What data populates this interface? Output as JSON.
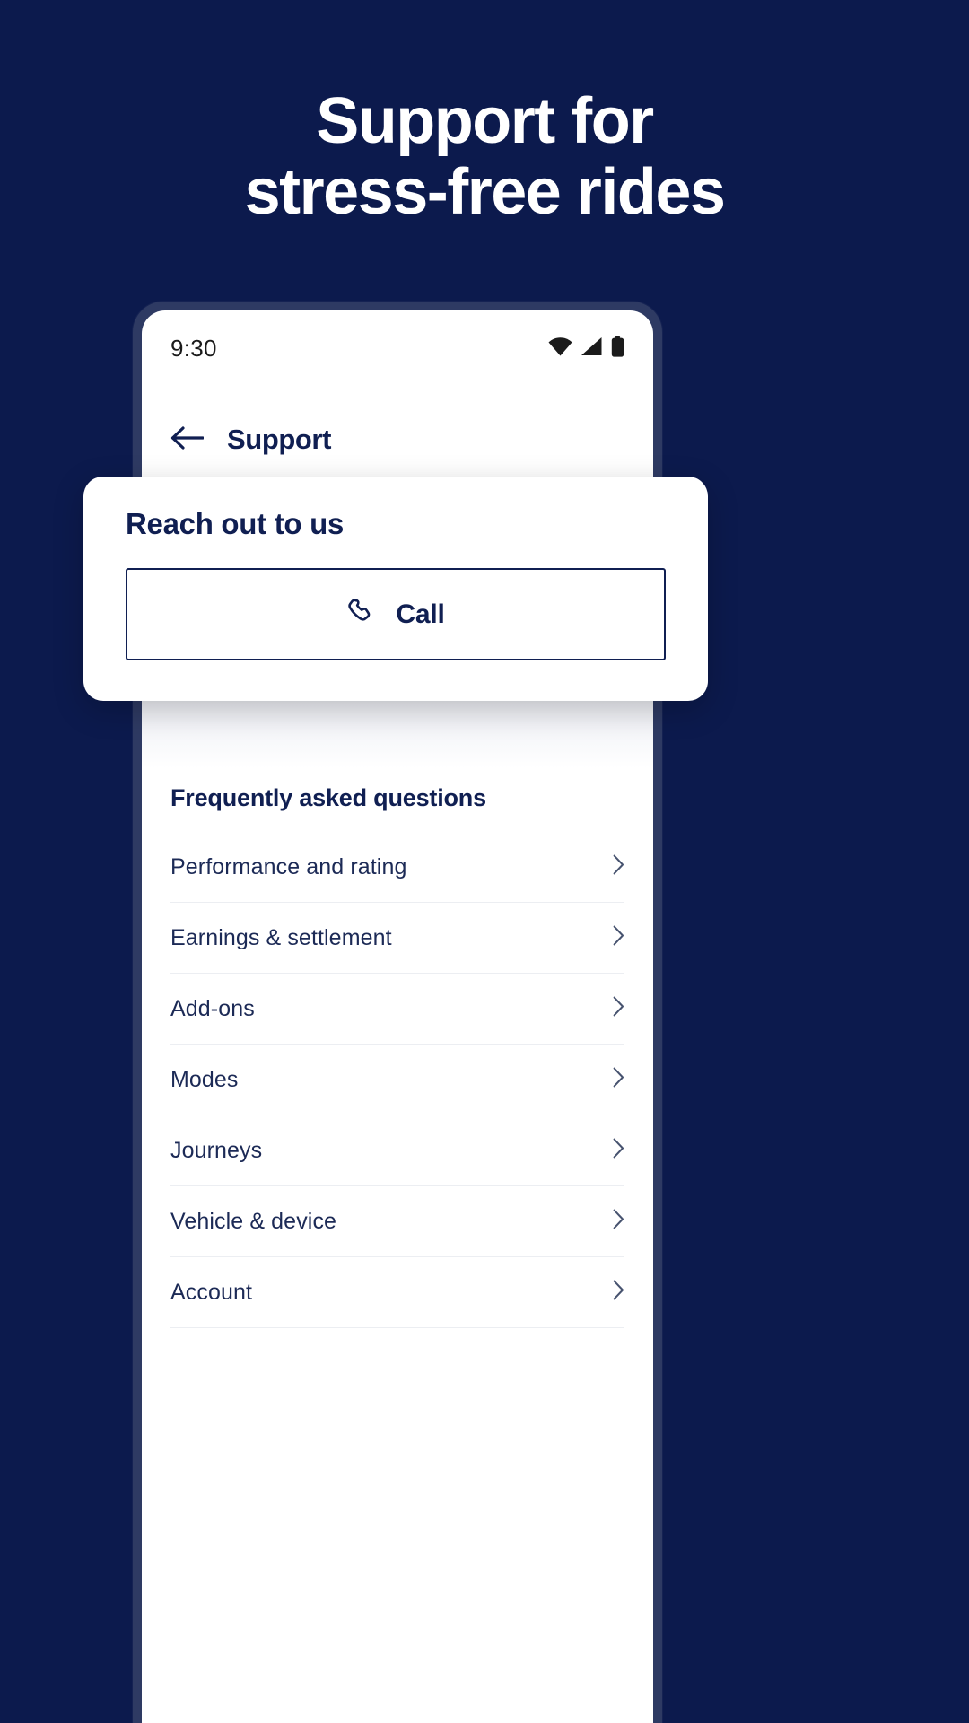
{
  "promo": {
    "background_color": "#0c1a4d",
    "headline_line1": "Support for",
    "headline_line2": "stress-free rides"
  },
  "phone": {
    "status_bar": {
      "time": "9:30",
      "icons": [
        "wifi-icon",
        "cellular-signal-icon",
        "battery-icon"
      ]
    },
    "nav": {
      "back_icon": "arrow-left-icon",
      "title": "Support"
    },
    "overlay_card": {
      "title": "Reach out to us",
      "call_button": {
        "icon": "phone-call-icon",
        "label": "Call"
      }
    },
    "faq": {
      "title": "Frequently asked questions",
      "chevron_icon": "chevron-right-icon",
      "items": [
        {
          "label": "Performance and rating"
        },
        {
          "label": "Earnings & settlement"
        },
        {
          "label": "Add-ons"
        },
        {
          "label": "Modes"
        },
        {
          "label": "Journeys"
        },
        {
          "label": "Vehicle & device"
        },
        {
          "label": "Account"
        }
      ]
    }
  },
  "colors": {
    "brand_navy": "#101f52",
    "page_background": "#0c1a4d",
    "phone_bezel": "#2e3a63",
    "divider": "#eceef2",
    "text_body": "#1c2a56"
  }
}
